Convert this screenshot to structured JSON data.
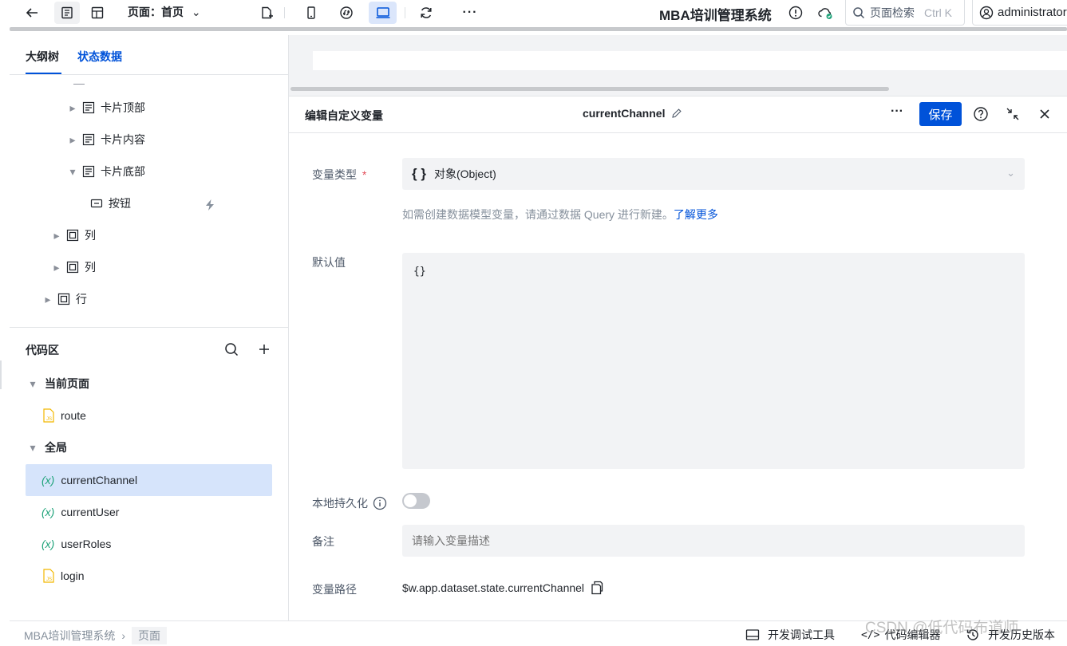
{
  "topbar": {
    "page_label": "页面：首页",
    "app_title": "MBA培训管理系统",
    "search_placeholder": "页面检索",
    "search_shortcut": "Ctrl K",
    "user": "administrator"
  },
  "left": {
    "tabs": [
      "大纲树",
      "状态数据"
    ],
    "tree": {
      "dash": "—",
      "card_top": "卡片顶部",
      "card_content": "卡片内容",
      "card_bottom": "卡片底部",
      "button": "按钮",
      "col1": "列",
      "col2": "列",
      "row": "行"
    },
    "code": {
      "title": "代码区",
      "current_page": "当前页面",
      "route": "route",
      "global": "全局",
      "items": [
        "currentChannel",
        "currentUser",
        "userRoles"
      ],
      "login": "login",
      "var_glyph": "(x)"
    }
  },
  "editor": {
    "title": "编辑自定义变量",
    "var_name": "currentChannel",
    "save": "保存",
    "type_label": "变量类型",
    "required_mark": "*",
    "type_glyph": "{ }",
    "type_value": "对象(Object)",
    "hint": "如需创建数据模型变量，请通过数据 Query 进行新建。",
    "hint_link": "了解更多",
    "default_label": "默认值",
    "default_value": "{}",
    "persist_label": "本地持久化",
    "persist_on": false,
    "note_label": "备注",
    "note_placeholder": "请输入变量描述",
    "path_label": "变量路径",
    "path_value": "$w.app.dataset.state.currentChannel"
  },
  "status": {
    "breadcrumb": [
      "MBA培训管理系统",
      "页面"
    ],
    "debug": "开发调试工具",
    "code_editor": "代码编辑器",
    "history": "开发历史版本",
    "watermark": "CSDN @低代码布道师"
  },
  "colors": {
    "accent": "#0052d9",
    "selected_bg": "#d6e4fb",
    "var_icon": "#1fa37a",
    "js_icon": "#f2b800"
  }
}
